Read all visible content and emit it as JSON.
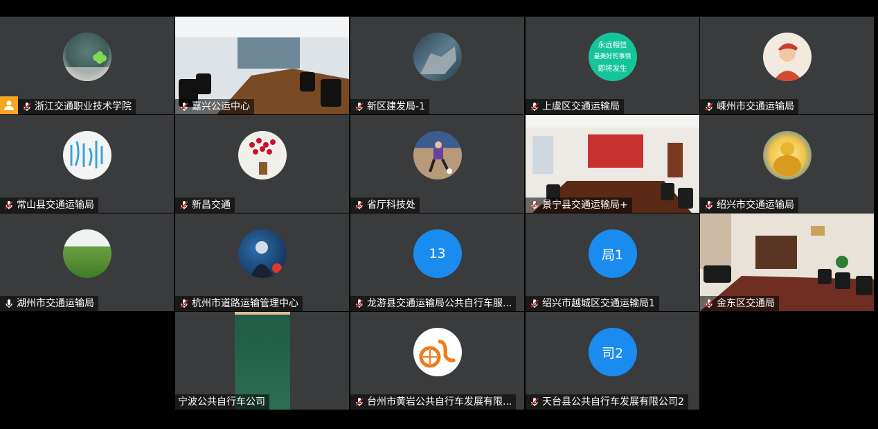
{
  "tiles": [
    {
      "name": "浙江交通职业技术学院",
      "avatar": "clover",
      "mic": "muted",
      "host": true
    },
    {
      "name": "嘉兴公运中心",
      "avatar": "video-room1",
      "mic": "muted"
    },
    {
      "name": "新区建发局-1",
      "avatar": "ship",
      "mic": "muted"
    },
    {
      "name": "上虞区交通运输局",
      "avatar": "text-circle",
      "avatar_text": [
        "永远相信",
        "最美好的事情",
        "即将发生"
      ],
      "mic": "muted"
    },
    {
      "name": "嵊州市交通运输局",
      "avatar": "cartoon-man",
      "mic": "muted"
    },
    {
      "name": "常山县交通运输局",
      "avatar": "calligraphy",
      "mic": "muted"
    },
    {
      "name": "新昌交通",
      "avatar": "flowers",
      "mic": "muted"
    },
    {
      "name": "省厅科技处",
      "avatar": "soccer",
      "mic": "muted"
    },
    {
      "name": "景宁县交通运输局+",
      "avatar": "video-room2",
      "mic": "muted"
    },
    {
      "name": "绍兴市交通运输局",
      "avatar": "buddha",
      "mic": "muted"
    },
    {
      "name": "湖州市交通运输局",
      "avatar": "tea-field",
      "mic": "on"
    },
    {
      "name": "杭州市道路运输管理中心",
      "avatar": "anime",
      "mic": "muted"
    },
    {
      "name": "龙游县交通运输局公共自行车服...",
      "avatar": "text",
      "avatar_label": "13",
      "mic": "muted"
    },
    {
      "name": "绍兴市越城区交通运输局1",
      "avatar": "text",
      "avatar_label": "局1",
      "mic": "muted"
    },
    {
      "name": "金东区交通局",
      "avatar": "video-room3",
      "mic": "muted"
    },
    {
      "name": "宁波公共自行车公司",
      "avatar": "chalkboard",
      "mic": "none"
    },
    {
      "name": "台州市黄岩公共自行车发展有限...",
      "avatar": "bike-logo",
      "mic": "muted"
    },
    {
      "name": "天台县公共自行车发展有限公司2",
      "avatar": "text",
      "avatar_label": "司2",
      "mic": "muted"
    }
  ],
  "colors": {
    "tile_bg": "#3a3b3d",
    "avatar_blue": "#1a8cf0",
    "host_badge": "#f5a623",
    "mute_red": "#e02020"
  }
}
